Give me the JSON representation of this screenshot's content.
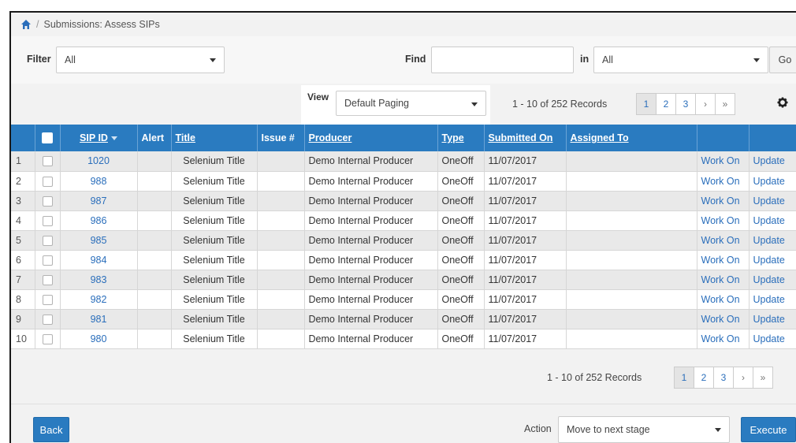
{
  "breadcrumb": {
    "home_icon": "home-icon",
    "separator": "/",
    "current": "Submissions: Assess SIPs"
  },
  "filter": {
    "label": "Filter",
    "value": "All"
  },
  "find": {
    "label": "Find",
    "value": "",
    "in_label": "in",
    "in_value": "All",
    "go_label": "Go"
  },
  "view": {
    "label": "View",
    "value": "Default Paging"
  },
  "paging": {
    "records": "1 - 10 of 252 Records",
    "pages": [
      "1",
      "2",
      "3"
    ],
    "next": "›",
    "last": "»",
    "active_page": "1"
  },
  "table": {
    "headers": {
      "sip_id": "SIP ID",
      "alert": "Alert",
      "title": "Title",
      "issue": "Issue #",
      "producer": "Producer",
      "type": "Type",
      "submitted_on": "Submitted On",
      "assigned_to": "Assigned To"
    },
    "rows": [
      {
        "num": "1",
        "sip_id": "1020",
        "title": "Selenium Title",
        "issue": "",
        "producer": "Demo Internal Producer",
        "type": "OneOff",
        "submitted_on": "11/07/2017",
        "assigned_to": "",
        "work_on": "Work On",
        "update": "Update"
      },
      {
        "num": "2",
        "sip_id": "988",
        "title": "Selenium Title",
        "issue": "",
        "producer": "Demo Internal Producer",
        "type": "OneOff",
        "submitted_on": "11/07/2017",
        "assigned_to": "",
        "work_on": "Work On",
        "update": "Update"
      },
      {
        "num": "3",
        "sip_id": "987",
        "title": "Selenium Title",
        "issue": "",
        "producer": "Demo Internal Producer",
        "type": "OneOff",
        "submitted_on": "11/07/2017",
        "assigned_to": "",
        "work_on": "Work On",
        "update": "Update"
      },
      {
        "num": "4",
        "sip_id": "986",
        "title": "Selenium Title",
        "issue": "",
        "producer": "Demo Internal Producer",
        "type": "OneOff",
        "submitted_on": "11/07/2017",
        "assigned_to": "",
        "work_on": "Work On",
        "update": "Update"
      },
      {
        "num": "5",
        "sip_id": "985",
        "title": "Selenium Title",
        "issue": "",
        "producer": "Demo Internal Producer",
        "type": "OneOff",
        "submitted_on": "11/07/2017",
        "assigned_to": "",
        "work_on": "Work On",
        "update": "Update"
      },
      {
        "num": "6",
        "sip_id": "984",
        "title": "Selenium Title",
        "issue": "",
        "producer": "Demo Internal Producer",
        "type": "OneOff",
        "submitted_on": "11/07/2017",
        "assigned_to": "",
        "work_on": "Work On",
        "update": "Update"
      },
      {
        "num": "7",
        "sip_id": "983",
        "title": "Selenium Title",
        "issue": "",
        "producer": "Demo Internal Producer",
        "type": "OneOff",
        "submitted_on": "11/07/2017",
        "assigned_to": "",
        "work_on": "Work On",
        "update": "Update"
      },
      {
        "num": "8",
        "sip_id": "982",
        "title": "Selenium Title",
        "issue": "",
        "producer": "Demo Internal Producer",
        "type": "OneOff",
        "submitted_on": "11/07/2017",
        "assigned_to": "",
        "work_on": "Work On",
        "update": "Update"
      },
      {
        "num": "9",
        "sip_id": "981",
        "title": "Selenium Title",
        "issue": "",
        "producer": "Demo Internal Producer",
        "type": "OneOff",
        "submitted_on": "11/07/2017",
        "assigned_to": "",
        "work_on": "Work On",
        "update": "Update"
      },
      {
        "num": "10",
        "sip_id": "980",
        "title": "Selenium Title",
        "issue": "",
        "producer": "Demo Internal Producer",
        "type": "OneOff",
        "submitted_on": "11/07/2017",
        "assigned_to": "",
        "work_on": "Work On",
        "update": "Update"
      }
    ]
  },
  "footer": {
    "back_label": "Back",
    "action_label": "Action",
    "action_value": "Move to next stage",
    "execute_label": "Execute"
  },
  "colors": {
    "accent": "#2a7bc0",
    "link": "#2a6ebb",
    "row_alt": "#e9e9e9"
  },
  "icons": {
    "home": "home-icon",
    "settings": "gear-icon",
    "caret": "caret-down-icon",
    "sort": "sort-desc-icon"
  }
}
